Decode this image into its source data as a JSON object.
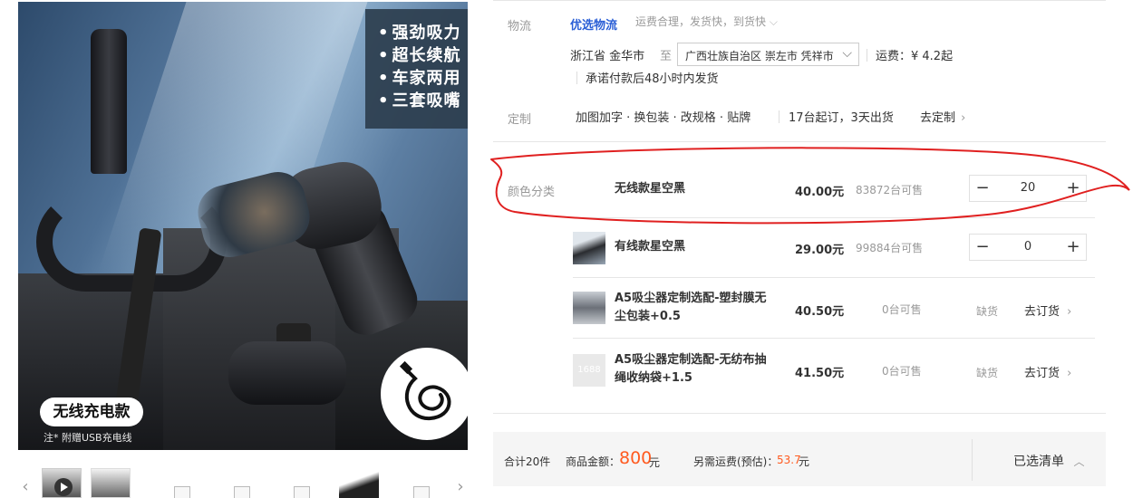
{
  "gallery": {
    "features": [
      "强劲吸力",
      "超长续航",
      "车家两用",
      "三套吸嘴"
    ],
    "badge": "无线充电款",
    "note": "注* 附赠USB充电线"
  },
  "logistics": {
    "label": "物流",
    "brand": "优选物流",
    "note": "运费合理，发货快，到货快",
    "origin": "浙江省 金华市",
    "to": "至",
    "destination": "广西壮族自治区 崇左市 凭祥市",
    "fee": "运费：¥ 4.2起",
    "promise": "承诺付款后48小时内发货"
  },
  "customize": {
    "label": "定制",
    "options": "加图加字 · 换包装 · 改规格 · 贴牌",
    "min_order": "17台起订，3天出货",
    "link": "去定制"
  },
  "color_category": {
    "label": "颜色分类"
  },
  "variants": [
    {
      "name": "无线款星空黑",
      "price": "40.00元",
      "stock": "83872台可售",
      "quantity": "20"
    },
    {
      "name": "有线款星空黑",
      "price": "29.00元",
      "stock": "99884台可售",
      "quantity": "0"
    },
    {
      "name": "A5吸尘器定制选配-塑封膜无尘包装+0.5",
      "price": "40.50元",
      "stock": "0台可售",
      "status": "缺货",
      "action": "去订货"
    },
    {
      "name": "A5吸尘器定制选配-无纺布抽绳收纳袋+1.5",
      "price": "41.50元",
      "stock": "0台可售",
      "status": "缺货",
      "action": "去订货"
    }
  ],
  "placeholder_thumb_text": "1688",
  "footer": {
    "count": "合计20件",
    "amount_label": "商品金额：",
    "amount": "800",
    "amount_unit": "元",
    "shipping_label": "另需运费(预估)：",
    "shipping": "53.7",
    "shipping_unit": "元",
    "selected_list": "已选清单"
  },
  "colors": {
    "brand_blue": "#2b5fd6",
    "price_orange": "#ff5a1f",
    "annotation_red": "#e02020"
  }
}
